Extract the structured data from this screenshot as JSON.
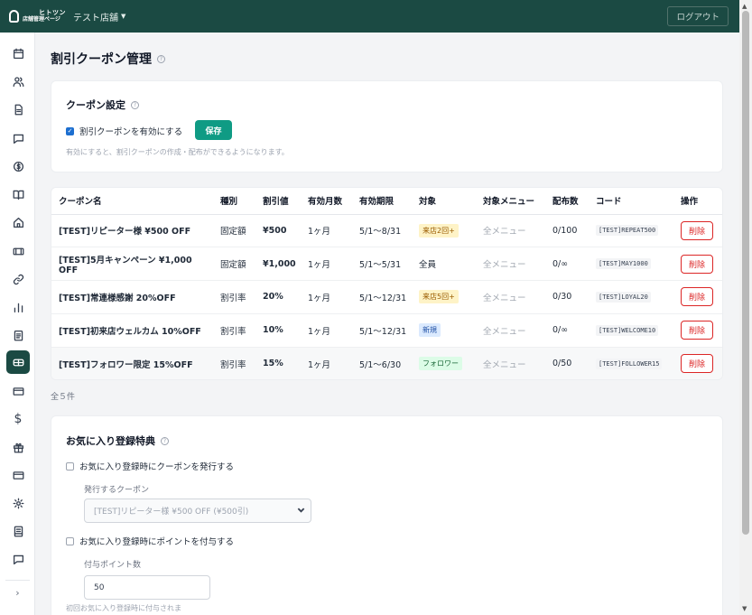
{
  "header": {
    "logo_line1": "ヒトツン",
    "logo_line2": "店舗管理ページ",
    "store_name": "テスト店舗",
    "logout_label": "ログアウト"
  },
  "sidebar": {
    "icons": [
      "calendar-icon",
      "users-icon",
      "document-icon",
      "chat-icon",
      "coin-icon",
      "book-icon",
      "home-icon",
      "ticket-icon",
      "link-icon",
      "bar-chart-icon",
      "clipboard-icon",
      "coupon-icon",
      "card-icon",
      "dollar-icon",
      "gift-icon",
      "card-icon",
      "gear-icon",
      "notebook-icon",
      "message-icon"
    ],
    "active": "coupon-icon",
    "dollar_glyph": "$",
    "expand_glyph": "›"
  },
  "page": {
    "title": "割引クーポン管理",
    "help_glyph": "?"
  },
  "settings": {
    "title": "クーポン設定",
    "enable_label": "割引クーポンを有効にする",
    "enable_checked": true,
    "save_label": "保存",
    "hint": "有効にすると、割引クーポンの作成・配布ができるようになります。"
  },
  "table": {
    "headers": [
      "クーポン名",
      "種別",
      "割引値",
      "有効月数",
      "有効期限",
      "対象",
      "対象メニュー",
      "配布数",
      "コード",
      "操作"
    ],
    "rows": [
      {
        "name": "[TEST]リピーター様 ¥500 OFF",
        "type": "固定額",
        "value": "¥500",
        "months": "1ヶ月",
        "period": "5/1〜8/31",
        "target": "来店2回+",
        "target_style": "yellow",
        "menu": "全メニュー",
        "dist": "0/100",
        "code": "[TEST]REPEAT500",
        "action": "削除"
      },
      {
        "name": "[TEST]5月キャンペーン ¥1,000 OFF",
        "type": "固定額",
        "value": "¥1,000",
        "months": "1ヶ月",
        "period": "5/1〜5/31",
        "target": "全員",
        "target_style": "plain",
        "menu": "全メニュー",
        "dist": "0/∞",
        "code": "[TEST]MAY1000",
        "action": "削除"
      },
      {
        "name": "[TEST]常連様感謝 20%OFF",
        "type": "割引率",
        "value": "20%",
        "months": "1ヶ月",
        "period": "5/1〜12/31",
        "target": "来店5回+",
        "target_style": "yellow",
        "menu": "全メニュー",
        "dist": "0/30",
        "code": "[TEST]LOYAL20",
        "action": "削除"
      },
      {
        "name": "[TEST]初来店ウェルカム 10%OFF",
        "type": "割引率",
        "value": "10%",
        "months": "1ヶ月",
        "period": "5/1〜12/31",
        "target": "新規",
        "target_style": "blue",
        "menu": "全メニュー",
        "dist": "0/∞",
        "code": "[TEST]WELCOME10",
        "action": "削除"
      },
      {
        "name": "[TEST]フォロワー限定 15%OFF",
        "type": "割引率",
        "value": "15%",
        "months": "1ヶ月",
        "period": "5/1〜6/30",
        "target": "フォロワー",
        "target_style": "green",
        "menu": "全メニュー",
        "dist": "0/50",
        "code": "[TEST]FOLLOWER15",
        "action": "削除"
      }
    ],
    "total_text": "全５件"
  },
  "favorite": {
    "title": "お気に入り登録特典",
    "coupon_check_label": "お気に入り登録時にクーポンを発行する",
    "coupon_checked": false,
    "coupon_select_label": "発行するクーポン",
    "coupon_select_value": "[TEST]リピーター様 ¥500 OFF (¥500引)",
    "point_check_label": "お気に入り登録時にポイントを付与する",
    "point_checked": false,
    "point_label": "付与ポイント数",
    "point_value": "50",
    "point_hint": "初回お気に入り登録時に付与されま"
  },
  "colors": {
    "header_bg": "#1b4a43",
    "accent_button": "#0f9b84",
    "delete_red": "#dc2626"
  }
}
